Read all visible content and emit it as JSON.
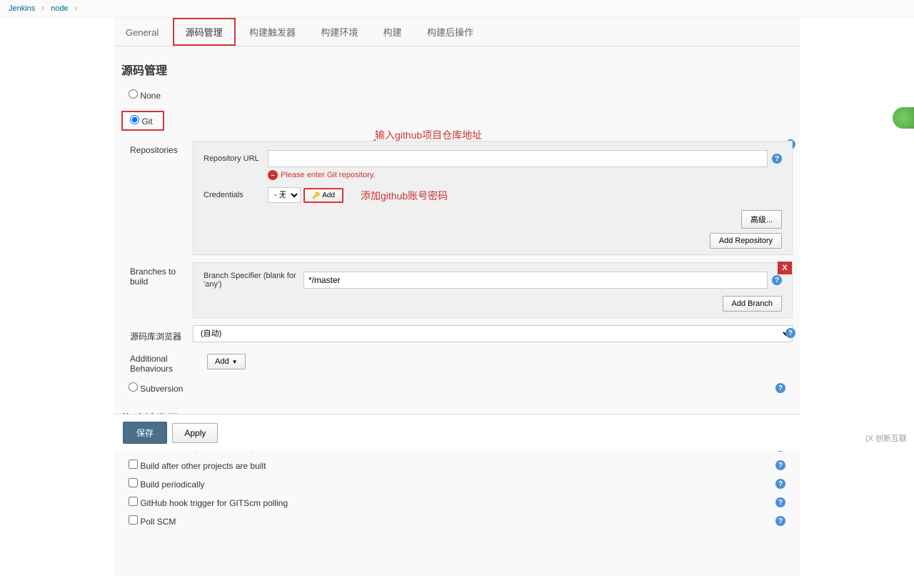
{
  "breadcrumb": {
    "root": "Jenkins",
    "node": "node"
  },
  "tabs": [
    {
      "label": "General"
    },
    {
      "label": "源码管理",
      "active": true
    },
    {
      "label": "构建触发器"
    },
    {
      "label": "构建环境"
    },
    {
      "label": "构建"
    },
    {
      "label": "构建后操作"
    }
  ],
  "scm": {
    "title": "源码管理",
    "none_label": "None",
    "git_label": "Git",
    "subversion_label": "Subversion",
    "repositories_label": "Repositories",
    "repo_url_label": "Repository URL",
    "repo_url_value": "",
    "error_msg": "Please enter Git repository.",
    "credentials_label": "Credentials",
    "credentials_none": "- 无 -",
    "add_cred_label": "Add",
    "advanced_label": "高级...",
    "add_repo_label": "Add Repository",
    "branches_label": "Branches to build",
    "branch_specifier_label": "Branch Specifier (blank for 'any')",
    "branch_specifier_value": "*/master",
    "add_branch_label": "Add Branch",
    "repo_browser_label": "源码库浏览器",
    "repo_browser_value": "(自动)",
    "additional_behaviours_label": "Additional Behaviours",
    "add_dropdown_label": "Add"
  },
  "annotations": {
    "url_hint": "输入github项目仓库地址",
    "cred_hint": "添加github账号密码"
  },
  "triggers": {
    "title": "构建触发器",
    "items": [
      "触发远程构建 (例如,使用脚本)",
      "Build after other projects are built",
      "Build periodically",
      "GitHub hook trigger for GITScm polling",
      "Poll SCM"
    ]
  },
  "buttons": {
    "save": "保存",
    "apply": "Apply"
  },
  "logo": "创新互联"
}
